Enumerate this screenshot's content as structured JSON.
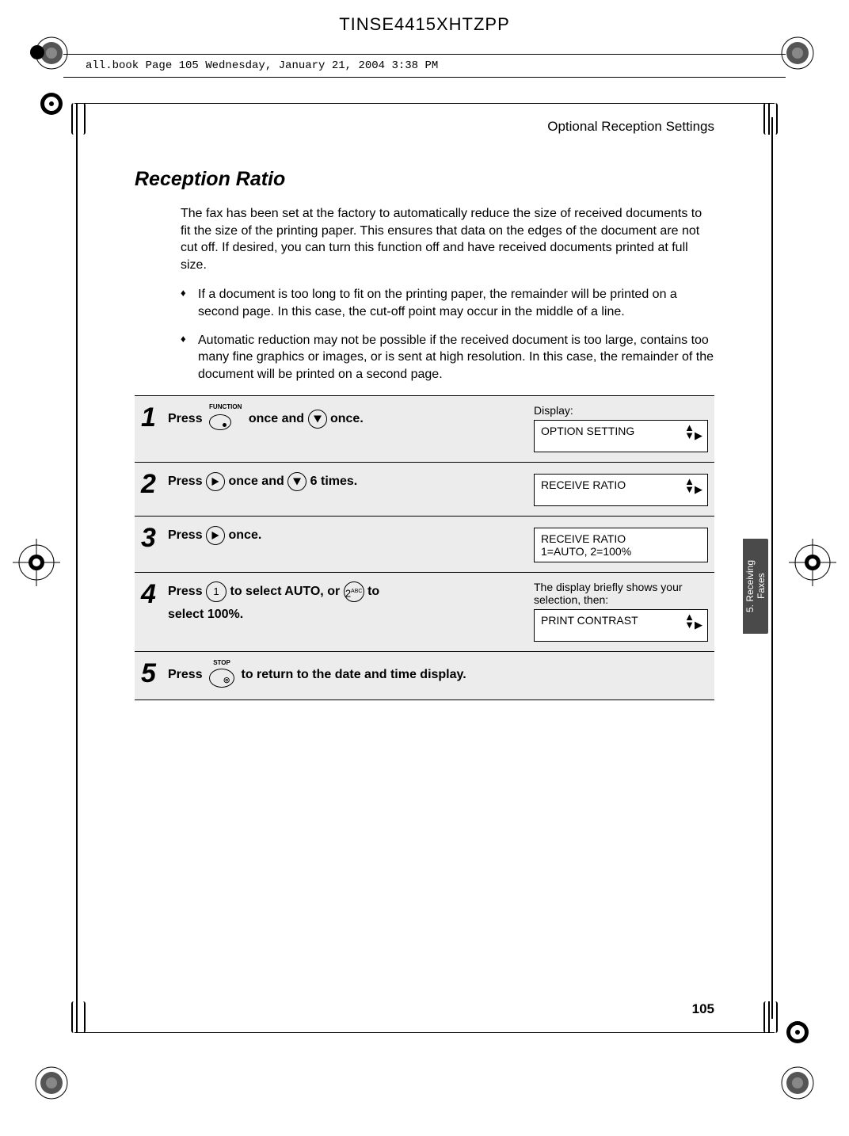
{
  "header_code": "TINSE4415XHTZPP",
  "book_line": "all.book  Page 105  Wednesday, January 21, 2004  3:38 PM",
  "section_title": "Optional Reception Settings",
  "heading": "Reception Ratio",
  "intro": "The fax has been set at the factory to automatically reduce the size of received documents to fit the size of the printing paper. This ensures that data on the edges of the document are not cut off. If desired, you can turn this function off and have received documents printed at full size.",
  "bullets": [
    "If a document is too long to fit on the printing paper, the remainder will be printed on a second page. In this case, the cut-off point may occur in the middle of a line.",
    "Automatic reduction may not be possible if the received document is too large, contains too many fine graphics or images, or is sent at high resolution. In this case, the remainder of the document will be printed on a second page."
  ],
  "steps": {
    "s1": {
      "num": "1",
      "pre": "Press ",
      "btn1_label": "FUNCTION",
      "mid": " once and ",
      "post": " once.",
      "disp_label": "Display:",
      "box": "OPTION SETTING"
    },
    "s2": {
      "num": "2",
      "pre": "Press ",
      "mid": " once and ",
      "post": " 6 times.",
      "box": "RECEIVE RATIO"
    },
    "s3": {
      "num": "3",
      "pre": "Press ",
      "post": " once.",
      "box_l1": "RECEIVE RATIO",
      "box_l2": "1=AUTO, 2=100%"
    },
    "s4": {
      "num": "4",
      "pre": "Press ",
      "key1": "1",
      "mid": " to select AUTO, or ",
      "key2": "2",
      "key2_sup": "ABC",
      "post": " to",
      "line2": "select 100%.",
      "disp_pre": "The display briefly shows your selection, then:",
      "box": "PRINT CONTRAST"
    },
    "s5": {
      "num": "5",
      "pre": "Press ",
      "btn_label": "STOP",
      "post": " to return to the date and time display."
    }
  },
  "side_tab": "5. Receiving\nFaxes",
  "page_number": "105"
}
